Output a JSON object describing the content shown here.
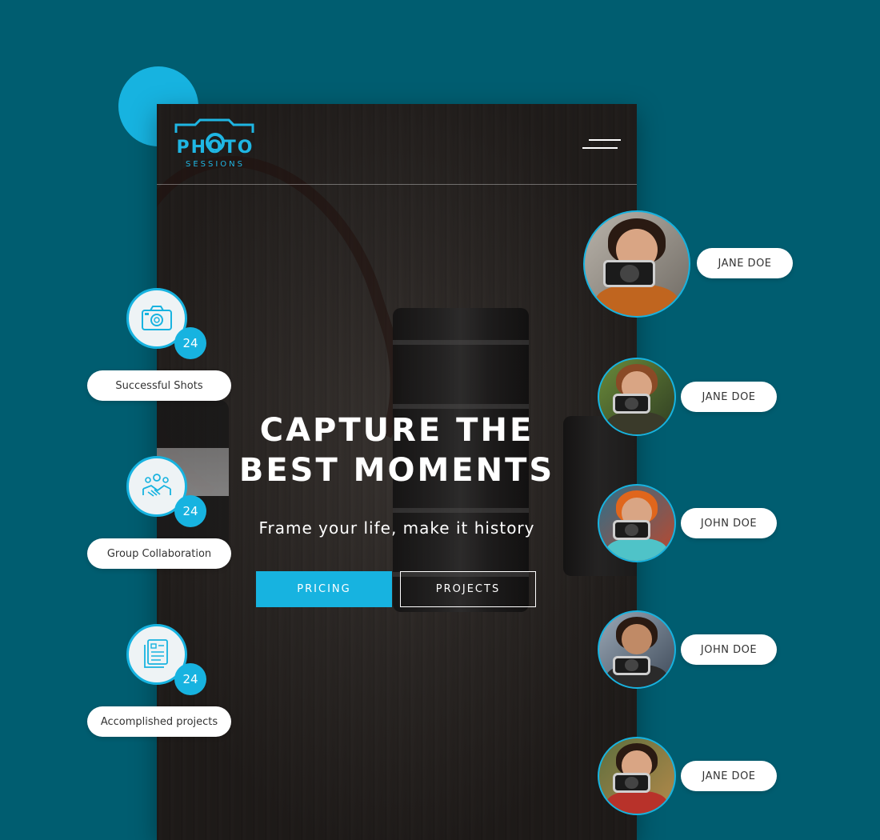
{
  "brand": {
    "logo_word": "PHOTO",
    "logo_sub": "SESSIONS"
  },
  "hero": {
    "headline_line1": "CAPTURE THE",
    "headline_line2": "BEST MOMENTS",
    "tagline": "Frame your life, make it history",
    "pricing_label": "PRICING",
    "projects_label": "PROJECTS"
  },
  "stats": [
    {
      "icon": "camera-icon",
      "count": "24",
      "label": "Successful Shots"
    },
    {
      "icon": "handshake-icon",
      "count": "24",
      "label": "Group Collaboration"
    },
    {
      "icon": "documents-icon",
      "count": "24",
      "label": "Accomplished projects"
    }
  ],
  "photographers": [
    {
      "name": "JANE DOE"
    },
    {
      "name": "JANE DOE"
    },
    {
      "name": "JOHN DOE"
    },
    {
      "name": "JOHN DOE"
    },
    {
      "name": "JANE DOE"
    }
  ],
  "colors": {
    "background": "#005d70",
    "accent": "#17b3e0",
    "pill": "#ffffff"
  }
}
